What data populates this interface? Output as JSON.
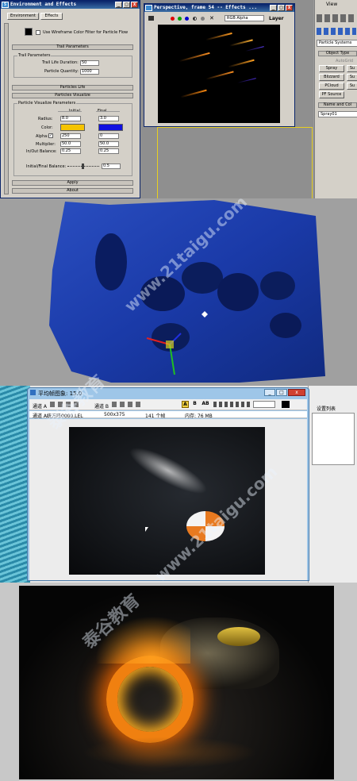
{
  "env": {
    "title": "Environment and Effects",
    "tabs": [
      "Environment",
      "Effects"
    ],
    "wireframe_label": "Use Wireframe Color Filter for Particle Flow",
    "sections": {
      "trail": "Trail Parameters",
      "life": "Particles Life",
      "visualize": "Particles Visualize",
      "apply": "Apply",
      "about": "About"
    },
    "trail_group": "Trail Parameters",
    "trail_life_label": "Trail Life Duration:",
    "trail_life_value": "50",
    "particle_qty_label": "Particle Quantity:",
    "particle_qty_value": "1000",
    "viz_group": "Particle Visualize Parameters",
    "initial_label": "Initial",
    "final_label": "Final",
    "radius_label": "Radius:",
    "radius_initial": "8.0",
    "radius_final": "3.0",
    "color_label": "Color:",
    "color_initial": "#f5c400",
    "color_final": "#1010e0",
    "alpha_label": "Alpha:",
    "alpha_initial": "250",
    "alpha_final": "0",
    "multiplier_label": "Multiplier:",
    "multiplier_initial": "50.0",
    "multiplier_final": "50.0",
    "inout_label": "In/Out Balance:",
    "inout_initial": "0.25",
    "inout_final": "0.25",
    "balance_label": "Initial/Final Balance:",
    "balance_value": "0.5"
  },
  "persp": {
    "title": "Perspective, frame 54 -- Effects ...",
    "channel": "RGB Alpha",
    "layer": "Layer"
  },
  "cmd": {
    "view_label": "View",
    "dropdown": "Particle Systems",
    "object_type": "Object Type",
    "autogrid": "AutoGrid",
    "buttons": [
      "Spray",
      "Su",
      "Blizzard",
      "Su",
      "PCloud",
      "Su",
      "PF Source"
    ],
    "name_color": "Name and Col",
    "name_value": "Spray01"
  },
  "frame": {
    "title": "平均帧图象: 15.0",
    "channel_label": "通道 A",
    "channel2_label": "通道 B",
    "status_channel": "通道 A:",
    "status_file": "统方阵0000.LEL",
    "status_size": "500x375",
    "status_frames": "141 个帧",
    "status_mem": "内存: 76 MB",
    "toolbar": [
      "A",
      "B",
      "AB"
    ],
    "side_label": "设置列表"
  },
  "watermark": {
    "brand": "泰谷教育",
    "url": "www.21taigu.com"
  }
}
